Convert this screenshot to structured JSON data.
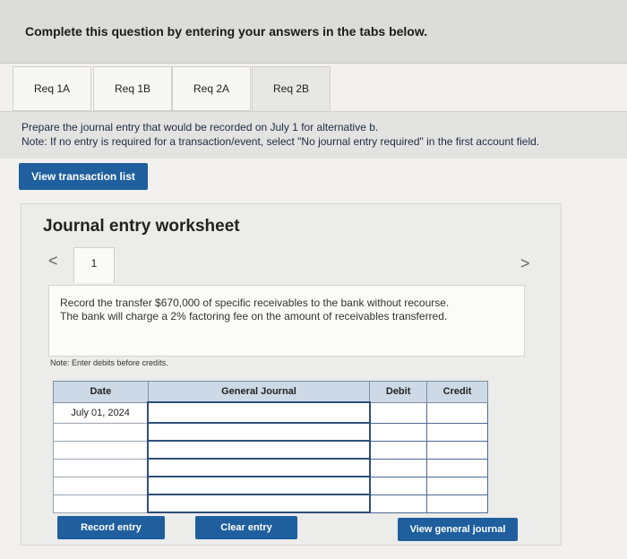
{
  "instruction": "Complete this question by entering your answers in the tabs below.",
  "tabs": [
    {
      "label": "Req 1A"
    },
    {
      "label": "Req 1B"
    },
    {
      "label": "Req 2A"
    },
    {
      "label": "Req 2B"
    }
  ],
  "prompt": {
    "line1": "Prepare the journal entry that would be recorded on July 1 for alternative b.",
    "line2": "Note: If no entry is required for a transaction/event, select \"No journal entry required\" in the first account field."
  },
  "view_transaction_list": "View transaction list",
  "worksheet": {
    "title": "Journal entry worksheet",
    "prev_icon": "<",
    "next_icon": ">",
    "entry_number": "1",
    "description": "Record the transfer $670,000 of specific receivables to the bank without recourse. The bank will charge a 2% factoring fee on the amount of receivables transferred.",
    "note": "Note: Enter debits before credits.",
    "table": {
      "headers": {
        "date": "Date",
        "general_journal": "General Journal",
        "debit": "Debit",
        "credit": "Credit"
      },
      "rows": [
        {
          "date": "July 01, 2024"
        },
        {
          "date": ""
        },
        {
          "date": ""
        },
        {
          "date": ""
        },
        {
          "date": ""
        },
        {
          "date": ""
        }
      ]
    },
    "buttons": {
      "record": "Record entry",
      "clear": "Clear entry",
      "view_general_journal": "View general journal"
    }
  }
}
